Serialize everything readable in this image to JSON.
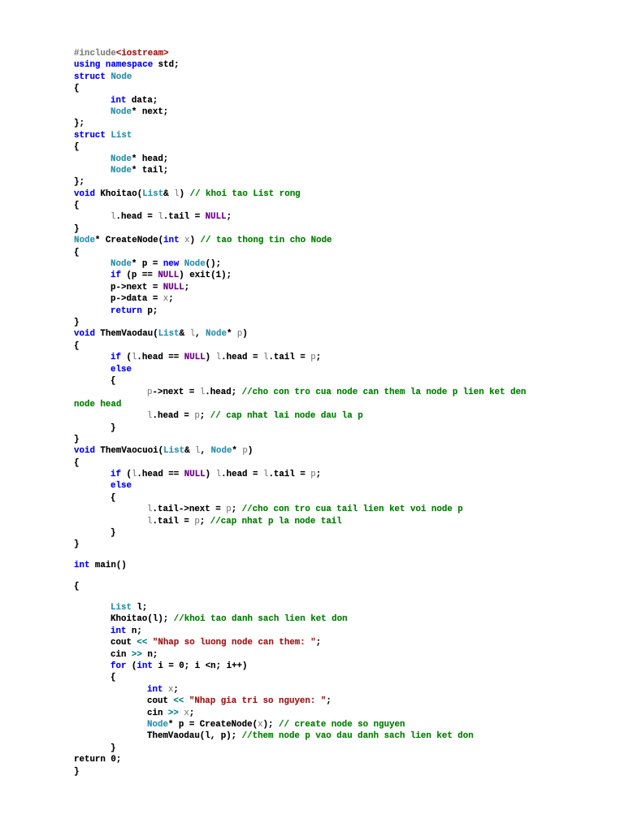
{
  "colors": {
    "keyword": "#0000ff",
    "type": "#2b91af",
    "comment": "#008000",
    "string": "#a31515",
    "macro": "#6f008a",
    "param": "#808080"
  },
  "code": {
    "lines": [
      [
        [
          "#include",
          "pp"
        ],
        [
          "<iostream>",
          "s"
        ]
      ],
      [
        [
          "using namespace",
          "k"
        ],
        [
          " std;"
        ]
      ],
      [
        [
          "struct",
          "k"
        ],
        [
          " "
        ],
        [
          "Node",
          "t"
        ]
      ],
      [
        [
          "{"
        ]
      ],
      [
        [
          "\t"
        ],
        [
          "int",
          "k"
        ],
        [
          " data;"
        ]
      ],
      [
        [
          "\t"
        ],
        [
          "Node",
          "t"
        ],
        [
          "* next;"
        ]
      ],
      [
        [
          "};"
        ]
      ],
      [
        [
          "struct",
          "k"
        ],
        [
          " "
        ],
        [
          "List",
          "t"
        ]
      ],
      [
        [
          "{"
        ]
      ],
      [
        [
          "\t"
        ],
        [
          "Node",
          "t"
        ],
        [
          "* head;"
        ]
      ],
      [
        [
          "\t"
        ],
        [
          "Node",
          "t"
        ],
        [
          "* tail;"
        ]
      ],
      [
        [
          "};"
        ]
      ],
      [
        [
          "void",
          "k"
        ],
        [
          " Khoitao("
        ],
        [
          "List",
          "t"
        ],
        [
          "& "
        ],
        [
          "l",
          "p"
        ],
        [
          ") "
        ],
        [
          "// khoi tao List rong",
          "c"
        ]
      ],
      [
        [
          "{"
        ]
      ],
      [
        [
          "\t"
        ],
        [
          "l",
          "p"
        ],
        [
          ".head = "
        ],
        [
          "l",
          "p"
        ],
        [
          ".tail = "
        ],
        [
          "NULL",
          "m"
        ],
        [
          ";"
        ]
      ],
      [
        [
          "}"
        ]
      ],
      [
        [
          "Node",
          "t"
        ],
        [
          "* CreateNode("
        ],
        [
          "int",
          "k"
        ],
        [
          " "
        ],
        [
          "x",
          "p"
        ],
        [
          ") "
        ],
        [
          "// tao thong tin cho Node",
          "c"
        ]
      ],
      [
        [
          "{"
        ]
      ],
      [
        [
          "\t"
        ],
        [
          "Node",
          "t"
        ],
        [
          "* p = "
        ],
        [
          "new",
          "k"
        ],
        [
          " "
        ],
        [
          "Node",
          "t"
        ],
        [
          "();"
        ]
      ],
      [
        [
          "\t"
        ],
        [
          "if",
          "k"
        ],
        [
          " (p == "
        ],
        [
          "NULL",
          "m"
        ],
        [
          ") exit(1);"
        ]
      ],
      [
        [
          "\t"
        ],
        [
          "p->next = "
        ],
        [
          "NULL",
          "m"
        ],
        [
          ";"
        ]
      ],
      [
        [
          "\t"
        ],
        [
          "p->data = "
        ],
        [
          "x",
          "p"
        ],
        [
          ";"
        ]
      ],
      [
        [
          "\t"
        ],
        [
          "return",
          "k"
        ],
        [
          " p;"
        ]
      ],
      [
        [
          "}"
        ]
      ],
      [
        [
          "void",
          "k"
        ],
        [
          " ThemVaodau("
        ],
        [
          "List",
          "t"
        ],
        [
          "& "
        ],
        [
          "l",
          "p"
        ],
        [
          ", "
        ],
        [
          "Node",
          "t"
        ],
        [
          "* "
        ],
        [
          "p",
          "p"
        ],
        [
          ")"
        ]
      ],
      [
        [
          "{"
        ]
      ],
      [
        [
          "\t"
        ],
        [
          "if",
          "k"
        ],
        [
          " ("
        ],
        [
          "l",
          "p"
        ],
        [
          ".head == "
        ],
        [
          "NULL",
          "m"
        ],
        [
          ") "
        ],
        [
          "l",
          "p"
        ],
        [
          ".head = "
        ],
        [
          "l",
          "p"
        ],
        [
          ".tail = "
        ],
        [
          "p",
          "p"
        ],
        [
          ";"
        ]
      ],
      [
        [
          "\t"
        ],
        [
          "else",
          "k"
        ]
      ],
      [
        [
          "\t"
        ],
        [
          "{"
        ]
      ],
      [
        [
          "\t\t"
        ],
        [
          "p",
          "p"
        ],
        [
          "->next = "
        ],
        [
          "l",
          "p"
        ],
        [
          ".head; "
        ],
        [
          "//cho con tro cua node can them la node p lien ket den",
          "c"
        ]
      ],
      [
        [
          "node head",
          "c"
        ]
      ],
      [
        [
          "\t\t"
        ],
        [
          "l",
          "p"
        ],
        [
          ".head = "
        ],
        [
          "p",
          "p"
        ],
        [
          "; "
        ],
        [
          "// cap nhat lai node dau la p",
          "c"
        ]
      ],
      [
        [
          "\t"
        ],
        [
          "}"
        ]
      ],
      [
        [
          "}"
        ]
      ],
      [
        [
          "void",
          "k"
        ],
        [
          " ThemVaocuoi("
        ],
        [
          "List",
          "t"
        ],
        [
          "& "
        ],
        [
          "l",
          "p"
        ],
        [
          ", "
        ],
        [
          "Node",
          "t"
        ],
        [
          "* "
        ],
        [
          "p",
          "p"
        ],
        [
          ")"
        ]
      ],
      [
        [
          "{"
        ]
      ],
      [
        [
          "\t"
        ],
        [
          "if",
          "k"
        ],
        [
          " ("
        ],
        [
          "l",
          "p"
        ],
        [
          ".head == "
        ],
        [
          "NULL",
          "m"
        ],
        [
          ") "
        ],
        [
          "l",
          "p"
        ],
        [
          ".head = "
        ],
        [
          "l",
          "p"
        ],
        [
          ".tail = "
        ],
        [
          "p",
          "p"
        ],
        [
          ";"
        ]
      ],
      [
        [
          "\t"
        ],
        [
          "else",
          "k"
        ]
      ],
      [
        [
          "\t"
        ],
        [
          "{"
        ]
      ],
      [
        [
          "\t\t"
        ],
        [
          "l",
          "p"
        ],
        [
          ".tail->next = "
        ],
        [
          "p",
          "p"
        ],
        [
          "; "
        ],
        [
          "//cho con tro cua tail lien ket voi node p",
          "c"
        ]
      ],
      [
        [
          "\t\t"
        ],
        [
          "l",
          "p"
        ],
        [
          ".tail = "
        ],
        [
          "p",
          "p"
        ],
        [
          "; "
        ],
        [
          "//cap nhat p la node tail",
          "c"
        ]
      ],
      [
        [
          "\t"
        ],
        [
          "}"
        ]
      ],
      [
        [
          "}"
        ]
      ],
      [],
      [
        [
          "int",
          "k"
        ],
        [
          " main()"
        ]
      ],
      [],
      [
        [
          "{"
        ]
      ],
      [],
      [
        [
          "\t"
        ],
        [
          "List",
          "t"
        ],
        [
          " l;"
        ]
      ],
      [
        [
          "\t"
        ],
        [
          "Khoitao(l); "
        ],
        [
          "//khoi tao danh sach lien ket don",
          "c"
        ]
      ],
      [
        [
          "\t"
        ],
        [
          "int",
          "k"
        ],
        [
          " n;"
        ]
      ],
      [
        [
          "\t"
        ],
        [
          "cout "
        ],
        [
          "<<",
          "o"
        ],
        [
          " "
        ],
        [
          "\"Nhap so luong node can them: \"",
          "s"
        ],
        [
          ";"
        ]
      ],
      [
        [
          "\t"
        ],
        [
          "cin "
        ],
        [
          ">>",
          "o"
        ],
        [
          " n;"
        ]
      ],
      [
        [
          "\t"
        ],
        [
          "for",
          "k"
        ],
        [
          " ("
        ],
        [
          "int",
          "k"
        ],
        [
          " i = 0; i <n; i++)"
        ]
      ],
      [
        [
          "\t"
        ],
        [
          "{"
        ]
      ],
      [
        [
          "\t\t"
        ],
        [
          "int",
          "k"
        ],
        [
          " "
        ],
        [
          "x",
          "p"
        ],
        [
          ";"
        ]
      ],
      [
        [
          "\t\t"
        ],
        [
          "cout "
        ],
        [
          "<<",
          "o"
        ],
        [
          " "
        ],
        [
          "\"Nhap gia tri so nguyen: \"",
          "s"
        ],
        [
          ";"
        ]
      ],
      [
        [
          "\t\t"
        ],
        [
          "cin "
        ],
        [
          ">>",
          "o"
        ],
        [
          " "
        ],
        [
          "x",
          "p"
        ],
        [
          ";"
        ]
      ],
      [
        [
          "\t\t"
        ],
        [
          "Node",
          "t"
        ],
        [
          "* p = CreateNode("
        ],
        [
          "x",
          "p"
        ],
        [
          "); "
        ],
        [
          "// create node so nguyen",
          "c"
        ]
      ],
      [
        [
          "\t\t"
        ],
        [
          "ThemVaodau(l, p); "
        ],
        [
          "//them node p vao dau danh sach lien ket don",
          "c"
        ]
      ],
      [
        [
          "\t"
        ],
        [
          "}"
        ]
      ],
      [
        [
          "return 0;"
        ]
      ],
      [
        [
          "}"
        ]
      ]
    ]
  }
}
